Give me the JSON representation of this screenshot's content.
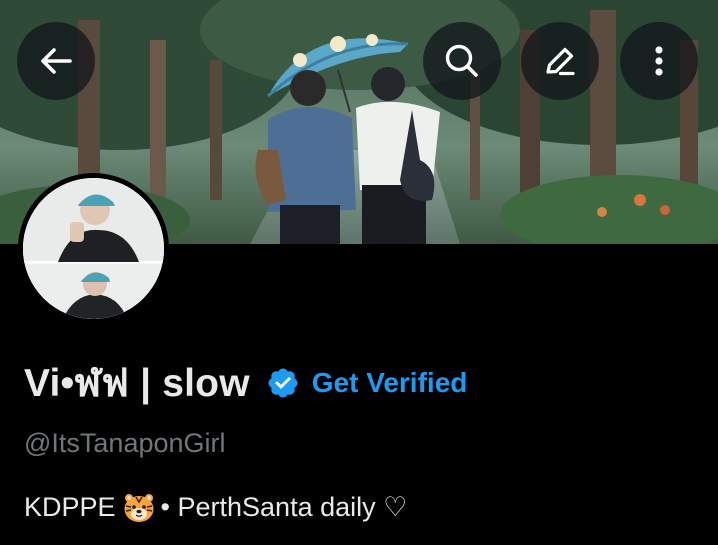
{
  "header": {
    "back_icon": "arrow-left-icon",
    "search_icon": "search-icon",
    "edit_icon": "pencil-icon",
    "more_icon": "more-vertical-icon"
  },
  "profile": {
    "display_name": "Vi•ฬฟ | slow",
    "verified_badge_icon": "verified-badge-icon",
    "get_verified_label": "Get Verified",
    "handle": "@ItsTanaponGirl",
    "bio": {
      "before_emoji": "KDPPE",
      "emoji_icon": "tiger-face-icon",
      "after_emoji": "• PerthSanta daily ♡"
    }
  },
  "colors": {
    "background": "#000000",
    "accent": "#1d9bf0",
    "text_primary": "#e7e9ea",
    "text_secondary": "#71767b"
  }
}
